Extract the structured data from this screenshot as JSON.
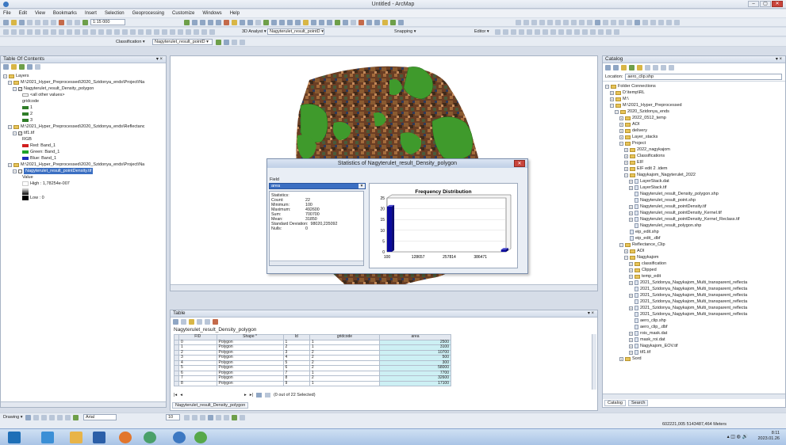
{
  "window": {
    "title": "Untitled - ArcMap",
    "minimize": "–",
    "maximize": "▢",
    "close": "✕"
  },
  "menu": [
    "File",
    "Edit",
    "View",
    "Bookmarks",
    "Insert",
    "Selection",
    "Geoprocessing",
    "Customize",
    "Windows",
    "Help"
  ],
  "toolbar": {
    "scale": "1:15 000",
    "classification_label": "Classification ▾",
    "layer_combo": "Nagyterulet_result_pointD ▾",
    "layer_combo2": "Nagyterulet_result_pointD ▾",
    "analyst_label": "3D Analyst ▾",
    "snapping_label": "Snapping ▾",
    "editor_label": "Editor ▾"
  },
  "toc": {
    "title": "Table Of Contents",
    "layers_label": "Layers",
    "group1": "M:\\2021_Hyper_Preprocessed\\2020_Szidonya_ends\\Project\\Na",
    "layer1": "Nagyterulet_result_Density_polygon",
    "all_other": "<all other values>",
    "gridcode": "gridcode",
    "classes": [
      "1",
      "2",
      "3"
    ],
    "group2": "M:\\2021_Hyper_Preprocessed\\2020_Szidonya_ends\\Reflectanc",
    "layer2": "tif1.tif",
    "rgb": "RGB",
    "bands": [
      "Red:   Band_1",
      "Green: Band_1",
      "Blue:  Band_1"
    ],
    "group3": "M:\\2021_Hyper_Preprocessed\\2020_Szidonya_ends\\Project\\Na",
    "layer3": "Nagyterulet_result_pointDensity.tif",
    "value_label": "Value",
    "high": "High : 1,78254e-007",
    "low": "Low : 0"
  },
  "dialog": {
    "title": "Statistics of Nagyterulet_result_Density_polygon",
    "field_label": "Field",
    "field_value": "area",
    "statistics_label": "Statistics:",
    "stats": [
      {
        "k": "Count:",
        "v": "22"
      },
      {
        "k": "Minimum:",
        "v": "100"
      },
      {
        "k": "Maximum:",
        "v": "492600"
      },
      {
        "k": "Sum:",
        "v": "700700"
      },
      {
        "k": "Mean:",
        "v": "31850"
      },
      {
        "k": "Standard Deviation:",
        "v": "98020,235092"
      },
      {
        "k": "Nulls:",
        "v": "0"
      }
    ]
  },
  "chart_data": {
    "type": "bar",
    "title": "Frequency Distribution",
    "xlabel": "",
    "ylabel": "",
    "x_ticks": [
      "100",
      "128657",
      "257814",
      "386471"
    ],
    "y_ticks": [
      "0",
      "5",
      "10",
      "15",
      "20",
      "25"
    ],
    "ylim": [
      0,
      25
    ],
    "xlim": [
      100,
      492600
    ],
    "bins": [
      {
        "from": 100,
        "to": 20000,
        "count": 21
      },
      {
        "from": 472000,
        "to": 492600,
        "count": 1
      }
    ],
    "colors": {
      "bar": "#0a0a9e",
      "plot_bg": "#ffffff",
      "axes": "#555555"
    }
  },
  "table": {
    "title": "Table",
    "table_name": "Nagyterulet_result_Density_polygon",
    "columns": [
      "FID",
      "Shape *",
      "Id",
      "gridcode",
      "area"
    ],
    "rows": [
      [
        "0",
        "Polygon",
        "1",
        "1",
        "2500"
      ],
      [
        "1",
        "Polygon",
        "2",
        "1",
        "3100"
      ],
      [
        "2",
        "Polygon",
        "3",
        "2",
        "10700"
      ],
      [
        "3",
        "Polygon",
        "4",
        "2",
        "500"
      ],
      [
        "4",
        "Polygon",
        "5",
        "2",
        "300"
      ],
      [
        "5",
        "Polygon",
        "6",
        "2",
        "58000"
      ],
      [
        "6",
        "Polygon",
        "7",
        "1",
        "7700"
      ],
      [
        "7",
        "Polygon",
        "8",
        "2",
        "32600"
      ],
      [
        "8",
        "Polygon",
        "9",
        "1",
        "17100"
      ]
    ],
    "selected_text": "(0 out of 22 Selected)",
    "footer_tab": "Nagyterulet_result_Density_polygon"
  },
  "catalog": {
    "title": "Catalog",
    "location_label": "Location:",
    "location_value": "aero_clip.shp",
    "tab_catalog": "Catalog",
    "tab_search": "Search",
    "items": [
      {
        "i": 0,
        "t": "folder",
        "e": "−",
        "label": "Folder Connections"
      },
      {
        "i": 1,
        "t": "folder",
        "e": "+",
        "label": "D:\\temp\\RL"
      },
      {
        "i": 1,
        "t": "folder",
        "e": "+",
        "label": "M:\\"
      },
      {
        "i": 1,
        "t": "folder",
        "e": "−",
        "label": "M:\\2021_Hyper_Preprocessed"
      },
      {
        "i": 2,
        "t": "folder",
        "e": "−",
        "label": "2020_Szidonya_ends"
      },
      {
        "i": 3,
        "t": "folder",
        "e": "+",
        "label": "2022_0512_temp"
      },
      {
        "i": 3,
        "t": "folder",
        "e": "+",
        "label": "AOI"
      },
      {
        "i": 3,
        "t": "folder",
        "e": "+",
        "label": "delivery"
      },
      {
        "i": 3,
        "t": "folder",
        "e": "+",
        "label": "Layer_stacks"
      },
      {
        "i": 3,
        "t": "folder",
        "e": "−",
        "label": "Project"
      },
      {
        "i": 4,
        "t": "folder",
        "e": "+",
        "label": "2022_nagykajom"
      },
      {
        "i": 4,
        "t": "folder",
        "e": "+",
        "label": "Classifications"
      },
      {
        "i": 4,
        "t": "folder",
        "e": "+",
        "label": "EIF"
      },
      {
        "i": 4,
        "t": "folder",
        "e": "+",
        "label": "EIF edit 2 .idem"
      },
      {
        "i": 4,
        "t": "folder",
        "e": "−",
        "label": "Nagykajom_Nagyterulet_2022"
      },
      {
        "i": 5,
        "t": "file",
        "e": "+",
        "label": "LayerStack.dat"
      },
      {
        "i": 5,
        "t": "file",
        "e": "+",
        "label": "LayerStack.tif"
      },
      {
        "i": 5,
        "t": "file",
        "e": "",
        "label": "Nagyterulet_result_Density_polygon.shp"
      },
      {
        "i": 5,
        "t": "file",
        "e": "",
        "label": "Nagyterulet_result_point.shp"
      },
      {
        "i": 5,
        "t": "file",
        "e": "+",
        "label": "Nagyterulet_result_pointDensity.tif"
      },
      {
        "i": 5,
        "t": "file",
        "e": "+",
        "label": "Nagyterulet_result_pointDensity_Kernel.tif"
      },
      {
        "i": 5,
        "t": "file",
        "e": "+",
        "label": "Nagyterulet_result_pointDensity_Kernel_Reclass.tif"
      },
      {
        "i": 5,
        "t": "file",
        "e": "",
        "label": "Nagyterulet_result_polygon.shp"
      },
      {
        "i": 4,
        "t": "file",
        "e": "",
        "label": "eip_edit.shp"
      },
      {
        "i": 4,
        "t": "file",
        "e": "",
        "label": "eip_edit_.dbf"
      },
      {
        "i": 3,
        "t": "folder",
        "e": "−",
        "label": "Reflectance_Clip"
      },
      {
        "i": 4,
        "t": "folder",
        "e": "+",
        "label": "AOI"
      },
      {
        "i": 4,
        "t": "folder",
        "e": "−",
        "label": "Nagykajom"
      },
      {
        "i": 5,
        "t": "folder",
        "e": "+",
        "label": "classification"
      },
      {
        "i": 5,
        "t": "folder",
        "e": "+",
        "label": "Clipped"
      },
      {
        "i": 5,
        "t": "folder",
        "e": "+",
        "label": "temp_edit"
      },
      {
        "i": 5,
        "t": "file",
        "e": "+",
        "label": "2021_Szidonya_Nagykajom_Multi_transparent_reflecta"
      },
      {
        "i": 5,
        "t": "file",
        "e": "",
        "label": "2021_Szidonya_Nagykajom_Multi_transparent_reflecta"
      },
      {
        "i": 5,
        "t": "file",
        "e": "+",
        "label": "2021_Szidonya_Nagykajom_Multi_transparent_reflecta"
      },
      {
        "i": 5,
        "t": "file",
        "e": "",
        "label": "2021_Szidonya_Nagykajom_Multi_transparent_reflecta"
      },
      {
        "i": 5,
        "t": "file",
        "e": "+",
        "label": "2021_Szidonya_Nagykajom_Multi_transparent_reflecta"
      },
      {
        "i": 5,
        "t": "file",
        "e": "",
        "label": "2021_Szidonya_Nagykajom_Multi_transparent_reflecta"
      },
      {
        "i": 5,
        "t": "file",
        "e": "",
        "label": "aero_clip.shp"
      },
      {
        "i": 5,
        "t": "file",
        "e": "",
        "label": "aero_clip_.dbf"
      },
      {
        "i": 5,
        "t": "file",
        "e": "+",
        "label": "rois_mask.dat"
      },
      {
        "i": 5,
        "t": "file",
        "e": "+",
        "label": "mask_roi.dat"
      },
      {
        "i": 5,
        "t": "file",
        "e": "+",
        "label": "Nagykajom_EOV.tif"
      },
      {
        "i": 5,
        "t": "file",
        "e": "+",
        "label": "tif1.tif"
      },
      {
        "i": 3,
        "t": "folder",
        "e": "+",
        "label": "Sord"
      }
    ]
  },
  "status": {
    "drawing_label": "Drawing ▾",
    "font_label": "Arial",
    "font_size": "10",
    "coords": "602221,005  5143487,464 Meters",
    "clock_time": "8:11",
    "clock_date": "2023.01.26"
  },
  "colors": {
    "accent": "#3b6fc2",
    "map_green": "#3f9a2c",
    "bar_blue": "#0a0a9e",
    "close_red": "#c9443b"
  }
}
